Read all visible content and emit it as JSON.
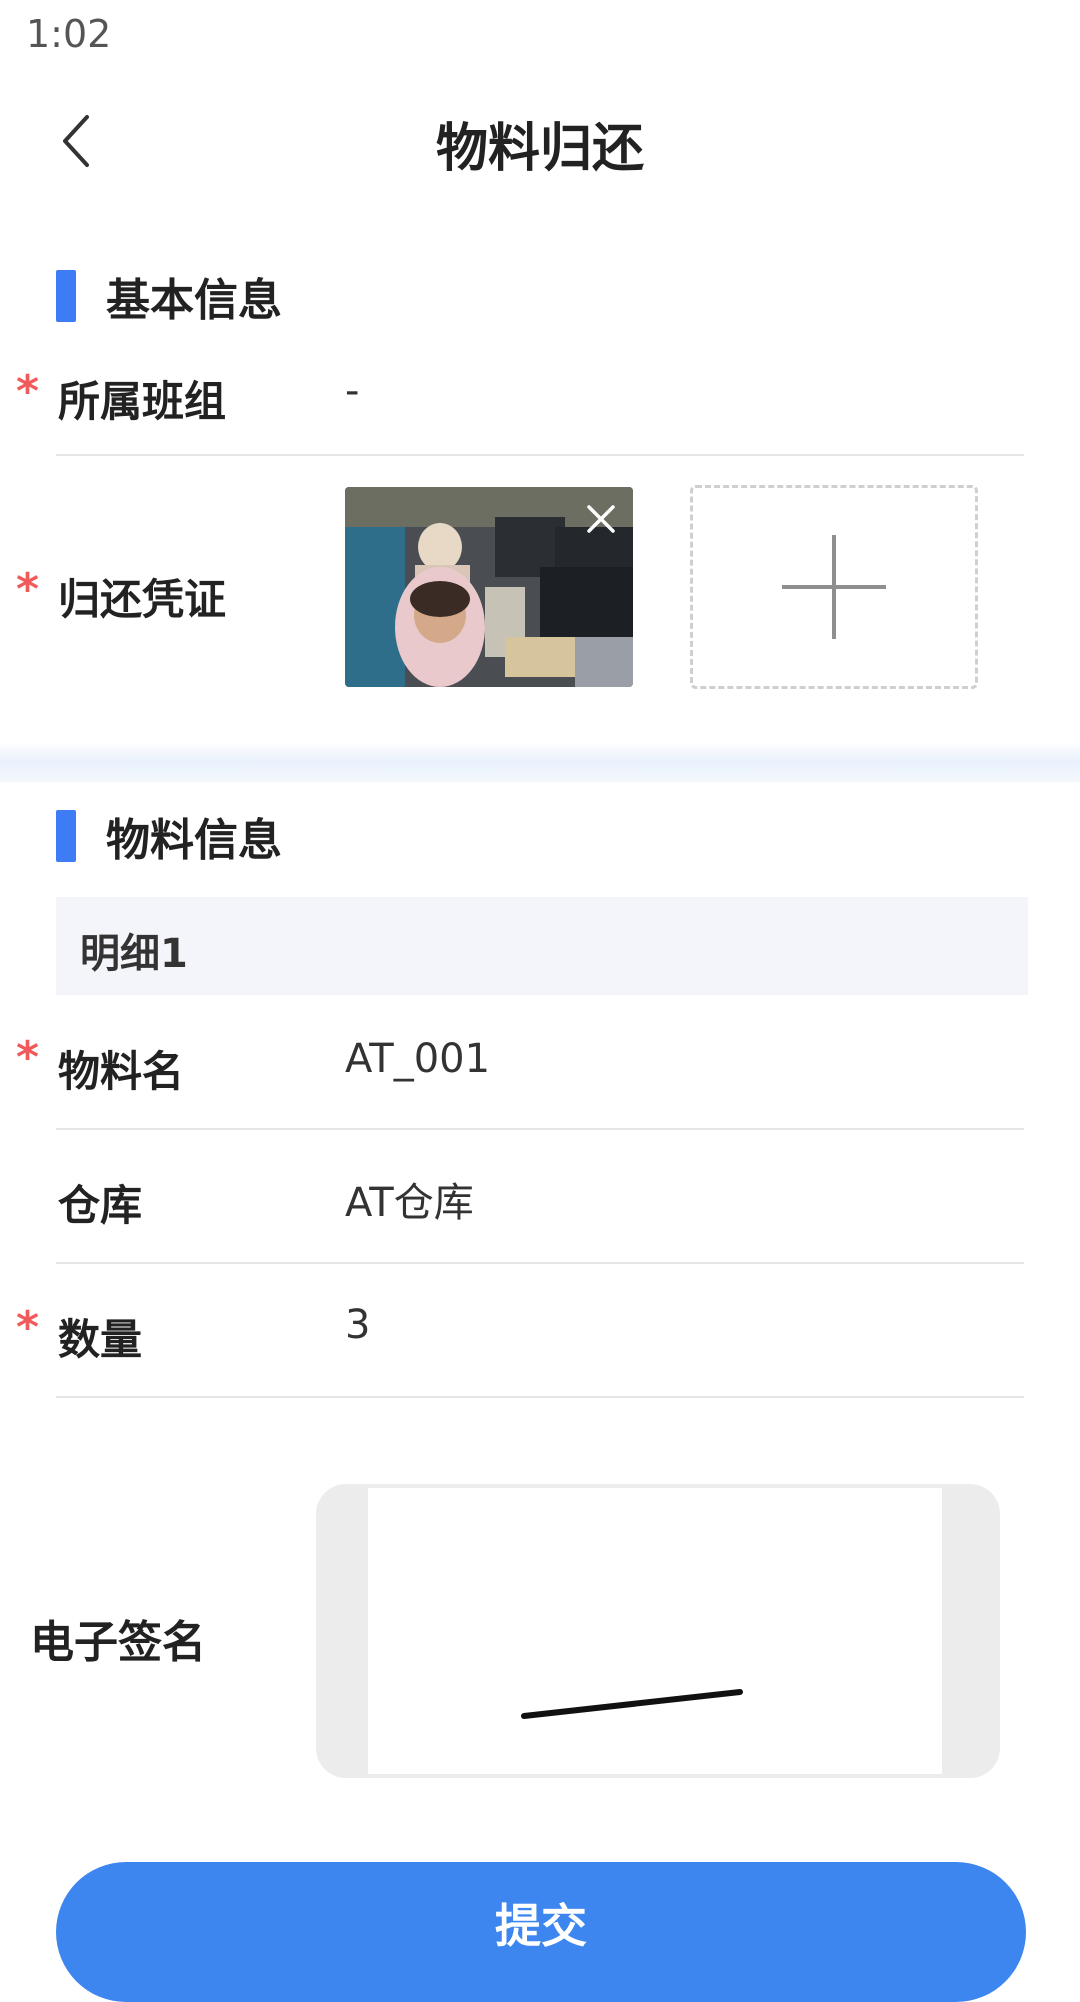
{
  "status_bar": {
    "time": "1:02"
  },
  "nav": {
    "title": "物料归还"
  },
  "basic_info": {
    "section_title": "基本信息",
    "team_label": "所属班组",
    "team_value": "-",
    "voucher_label": "归还凭证"
  },
  "material_info": {
    "section_title": "物料信息",
    "detail_title": "明细1",
    "name_label": "物料名",
    "name_value": "AT_001",
    "warehouse_label": "仓库",
    "warehouse_value": "AT仓库",
    "quantity_label": "数量",
    "quantity_value": "3"
  },
  "signature": {
    "label": "电子签名"
  },
  "submit": {
    "label": "提交"
  },
  "required_mark": "*",
  "colors": {
    "accent": "#3d7cf5",
    "required": "#f05a5a",
    "button": "#3d86ef"
  }
}
